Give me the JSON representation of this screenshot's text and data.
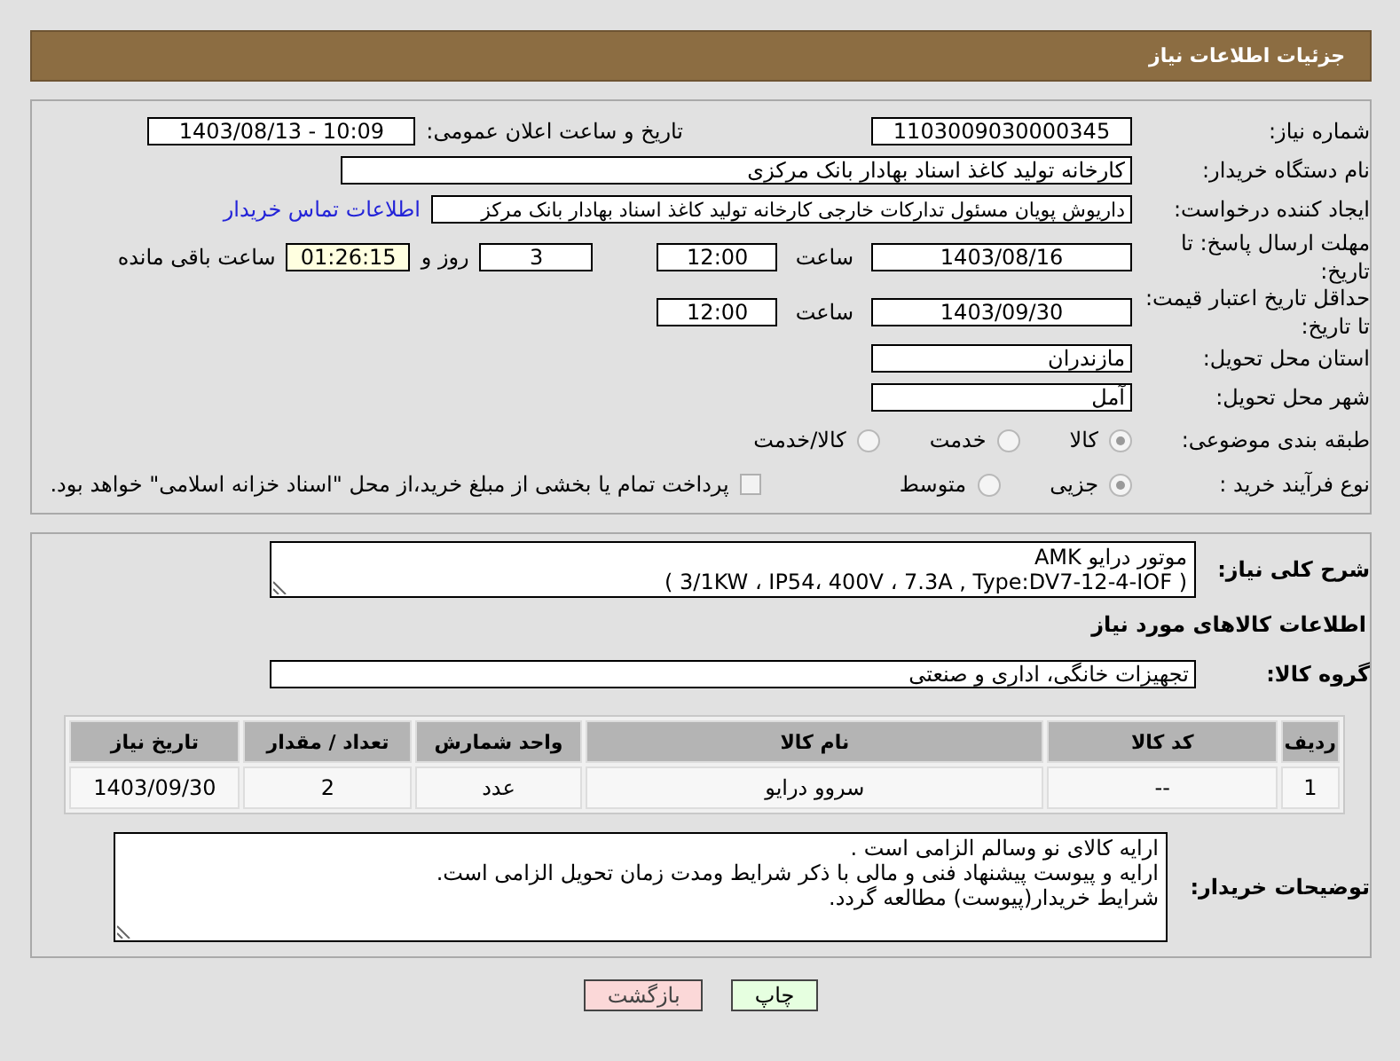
{
  "header": {
    "title": "جزئیات اطلاعات نیاز"
  },
  "need_number": {
    "label": "شماره نیاز:",
    "value": "1103009030000345"
  },
  "announce": {
    "label": "تاریخ و ساعت اعلان عمومی:",
    "value": "1403/08/13 - 10:09"
  },
  "buyer": {
    "label": "نام دستگاه خریدار:",
    "value": "کارخانه تولید کاغذ اسناد بهادار بانک مرکزی"
  },
  "requester": {
    "label": "ایجاد کننده درخواست:",
    "value": "داریوش  پویان مسئول تدارکات خارجی کارخانه تولید کاغذ اسناد بهادار بانک مرکز",
    "link": "اطلاعات تماس خریدار"
  },
  "reply_deadline": {
    "label": "مهلت ارسال پاسخ: تا تاریخ:",
    "date": "1403/08/16",
    "time_label": "ساعت",
    "time": "12:00",
    "days": "3",
    "days_label": "روز و",
    "remaining": "01:26:15",
    "remaining_label": "ساعت باقی مانده"
  },
  "price_validity": {
    "label": "حداقل تاریخ اعتبار قیمت: تا تاریخ:",
    "date": "1403/09/30",
    "time_label": "ساعت",
    "time": "12:00"
  },
  "province": {
    "label": "استان محل تحویل:",
    "value": "مازندران"
  },
  "city": {
    "label": "شهر محل تحویل:",
    "value": "آمل"
  },
  "category": {
    "label": "طبقه بندی موضوعی:",
    "options": [
      {
        "label": "کالا",
        "selected": true
      },
      {
        "label": "خدمت",
        "selected": false
      },
      {
        "label": "کالا/خدمت",
        "selected": false
      }
    ]
  },
  "process": {
    "label": "نوع فرآیند خرید :",
    "options": [
      {
        "label": "جزیی",
        "selected": true
      },
      {
        "label": "متوسط",
        "selected": false
      }
    ],
    "payment": {
      "label": "پرداخت تمام یا بخشی از مبلغ خرید،از محل \"اسناد خزانه اسلامی\" خواهد بود.",
      "checked": false
    }
  },
  "description": {
    "label": "شرح کلی نیاز:",
    "lines": [
      "موتور درایو AMK",
      "( 3/1KW ، IP54، 400V ، 7.3A , Type:DV7-12-4-IOF  )"
    ]
  },
  "goods_heading": "اطلاعات کالاهای مورد نیاز",
  "goods_group": {
    "label": "گروه کالا:",
    "value": "تجهیزات خانگی، اداری و صنعتی"
  },
  "table": {
    "columns": [
      "ردیف",
      "کد کالا",
      "نام کالا",
      "واحد شمارش",
      "تعداد / مقدار",
      "تاریخ نیاز"
    ],
    "rows": [
      [
        "1",
        "--",
        "سروو درایو",
        "عدد",
        "2",
        "1403/09/30"
      ]
    ]
  },
  "buyer_notes": {
    "label": "توضیحات خریدار:",
    "lines": [
      "ارایه کالای نو وسالم الزامی است .",
      "ارایه و پیوست پیشنهاد فنی و مالی با ذکر شرایط ومدت زمان تحویل الزامی است.",
      "شرایط  خریدار(پیوست) مطالعه گردد."
    ]
  },
  "buttons": [
    {
      "label": "چاپ",
      "kind": "print"
    },
    {
      "label": "بازگشت",
      "kind": "back"
    }
  ]
}
